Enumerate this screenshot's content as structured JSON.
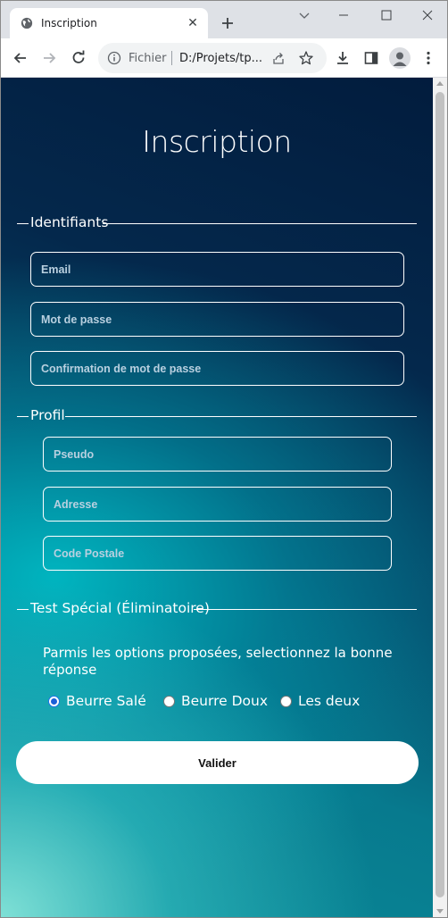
{
  "browser": {
    "tab_title": "Inscription",
    "omnibox_scheme": "Fichier",
    "omnibox_url": "D:/Projets/tp..."
  },
  "page": {
    "title": "Inscription",
    "sections": {
      "identifiants": {
        "legend": "Identifiants",
        "email_placeholder": "Email",
        "password_placeholder": "Mot de passe",
        "confirm_placeholder": "Confirmation de mot de passe"
      },
      "profil": {
        "legend": "Profil",
        "pseudo_placeholder": "Pseudo",
        "adresse_placeholder": "Adresse",
        "code_postal_placeholder": "Code Postale"
      },
      "test": {
        "legend": "Test Spécial (Éliminatoire)",
        "question": "Parmis les options proposées, selectionnez la bonne réponse",
        "options": [
          "Beurre Salé",
          "Beurre Doux",
          "Les deux"
        ],
        "selected": "Beurre Salé"
      }
    },
    "submit_label": "Valider"
  }
}
